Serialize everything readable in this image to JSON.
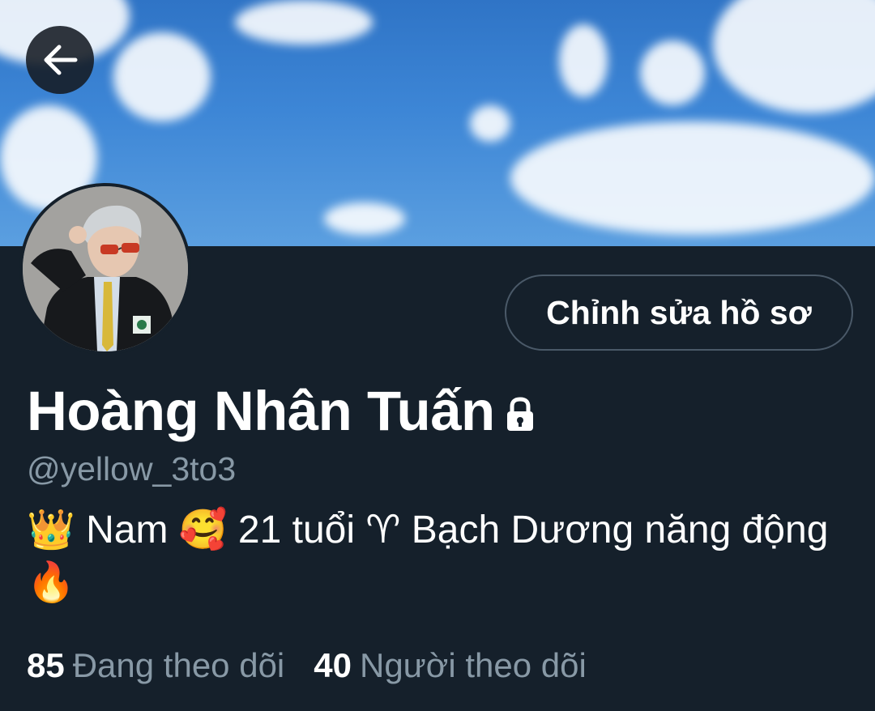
{
  "profile": {
    "display_name": "Hoàng Nhân Tuấn",
    "handle": "@yellow_3to3",
    "bio": {
      "crown": "👑",
      "gender": "Nam",
      "smile": "🥰",
      "age": "21 tuổi",
      "aries": "♈",
      "zodiac": "Bạch Dương năng động",
      "fire": "🔥"
    },
    "edit_label": "Chỉnh sửa hồ sơ"
  },
  "stats": {
    "following_count": "85",
    "following_label": "Đang theo dõi",
    "followers_count": "40",
    "followers_label": "Người theo dõi"
  },
  "icons": {
    "back": "arrow-left-icon",
    "lock": "lock-icon"
  },
  "colors": {
    "background": "#15202b",
    "secondary_text": "#8899a6",
    "button_border": "#4a5968",
    "sky": "#3d86d6"
  }
}
